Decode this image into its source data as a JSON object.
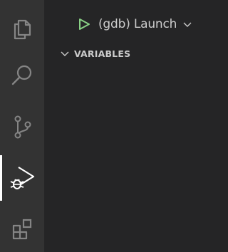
{
  "activity_bar": {
    "items": [
      {
        "icon": "files-icon"
      },
      {
        "icon": "search-icon"
      },
      {
        "icon": "source-control-icon"
      },
      {
        "icon": "run-debug-icon",
        "active": true
      },
      {
        "icon": "extensions-icon"
      }
    ]
  },
  "debug": {
    "configuration_label": "(gdb) Launch",
    "play_color": "#89d185"
  },
  "sections": {
    "variables_title": "VARIABLES"
  },
  "colors": {
    "activity_bar_bg": "#333333",
    "sidebar_bg": "#252526",
    "icon_inactive": "#858585",
    "icon_active": "#ffffff",
    "text": "#cccccc"
  }
}
